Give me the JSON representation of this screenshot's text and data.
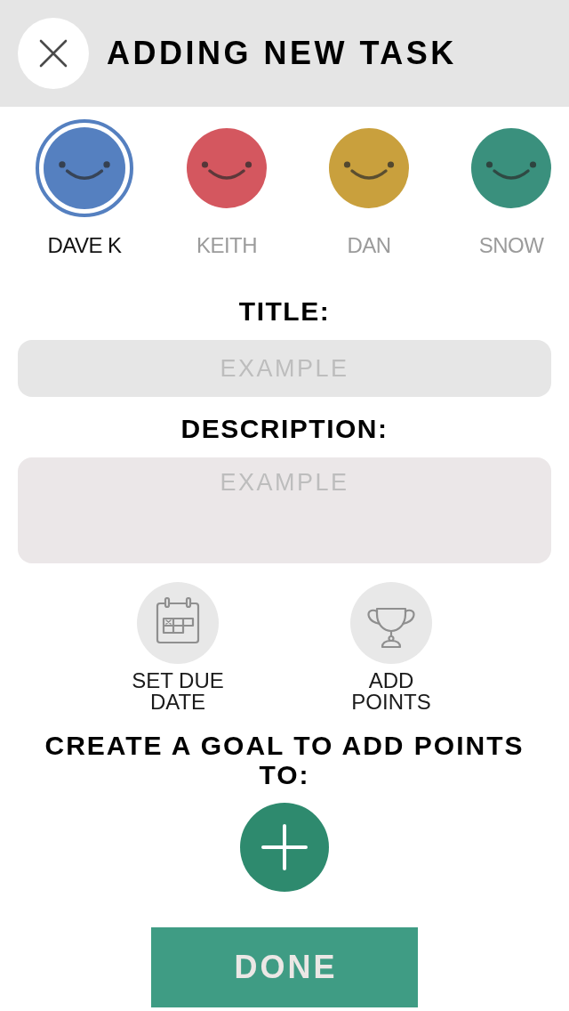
{
  "header": {
    "title": "ADDING NEW TASK"
  },
  "assignees": [
    {
      "name": "DAVE K",
      "color": "#5580c0",
      "selected": true
    },
    {
      "name": "KEITH",
      "color": "#d4575f",
      "selected": false
    },
    {
      "name": "DAN",
      "color": "#c9a03d",
      "selected": false
    },
    {
      "name": "SNOW",
      "color": "#3a907d",
      "selected": false
    }
  ],
  "title_field": {
    "label": "TITLE:",
    "placeholder": "EXAMPLE"
  },
  "description_field": {
    "label": "DESCRIPTION:",
    "placeholder": "EXAMPLE"
  },
  "actions": [
    {
      "kind": "calendar",
      "label": "SET DUE DATE"
    },
    {
      "kind": "trophy",
      "label": "ADD POINTS"
    }
  ],
  "goal": {
    "prompt": "CREATE A GOAL TO ADD POINTS TO:"
  },
  "done_button": {
    "label": "DONE"
  }
}
